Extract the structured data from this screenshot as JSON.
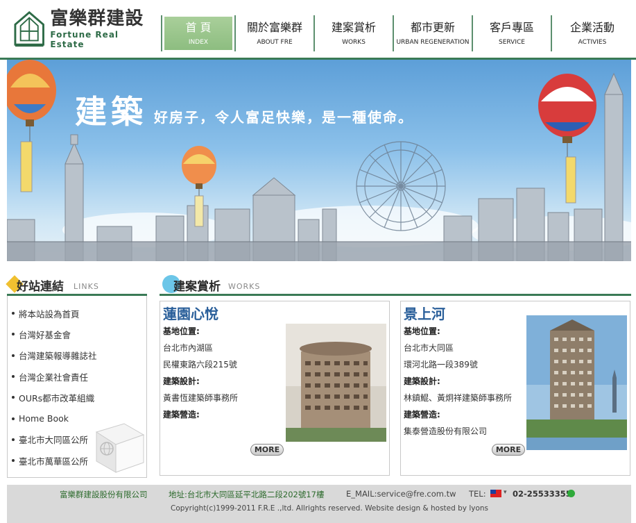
{
  "brand": {
    "name_cn": "富樂群建設",
    "name_en": "Fortune Real Estate"
  },
  "nav": [
    {
      "cn": "首 頁",
      "en": "INDEX",
      "active": true
    },
    {
      "cn": "關於富樂群",
      "en": "ABOUT FRE"
    },
    {
      "cn": "建案賞析",
      "en": "WORKS"
    },
    {
      "cn": "都市更新",
      "en": "URBAN REGENERATION"
    },
    {
      "cn": "客戶專區",
      "en": "SERVICE"
    },
    {
      "cn": "企業活動",
      "en": "ACTIVIES"
    }
  ],
  "banner": {
    "slogan_big": "建築",
    "slogan_small": "好房子，令人富足快樂，是一種使命。"
  },
  "links": {
    "title_cn": "好站連結",
    "title_en": "LINKS",
    "items": [
      "將本站設為首頁",
      "台灣好基金會",
      "台灣建築報導雜誌社",
      "台灣企業社會責任",
      "OURs都市改革組織",
      "Home Book",
      "臺北市大同區公所",
      "臺北市萬華區公所"
    ]
  },
  "works": {
    "title_cn": "建案賞析",
    "title_en": "WORKS",
    "more_label": "MORE",
    "items": [
      {
        "name": "蓮園心悅",
        "site_label": "基地位置:",
        "site_line1": "台北市內湖區",
        "site_line2": "民權東路六段215號",
        "design_label": "建築設計:",
        "design": "黃書恆建築師事務所",
        "builder_label": "建築營造:",
        "builder": ""
      },
      {
        "name": "景上河",
        "site_label": "基地位置:",
        "site_line1": "台北市大同區",
        "site_line2": "環河北路一段389號",
        "design_label": "建築設計:",
        "design": "林鎮鯤、黃炯祥建築師事務所",
        "builder_label": "建築營造:",
        "builder": "集泰營造股份有限公司"
      }
    ]
  },
  "footer": {
    "company": "富樂群建設股份有限公司",
    "address": "地址:台北市大同區延平北路二段202號17樓",
    "email": "E_MAIL:service@fre.com.tw",
    "tel_label": "TEL:",
    "phone": "02-25533355",
    "copyright": "Copyright(c)1999-2011    F.R.E .,ltd. Allrights reserved. Website design & hosted by lyons"
  },
  "colors": {
    "accent_green": "#3a7a56",
    "nav_active": "#98c58a",
    "work_title": "#2a5f9a",
    "footer_bg": "#d9d9d9"
  }
}
